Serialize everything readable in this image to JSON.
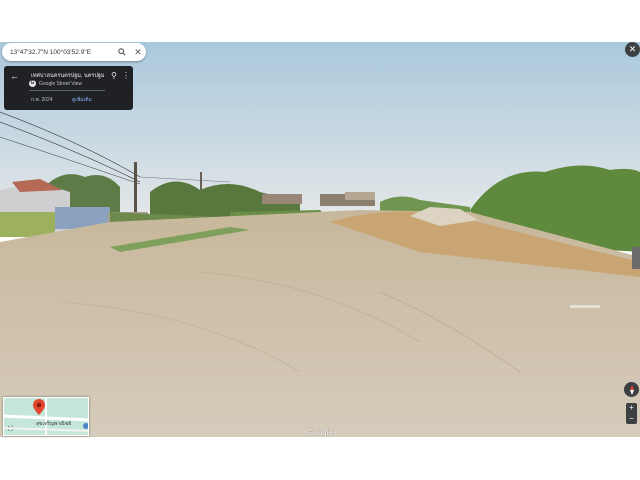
{
  "search": {
    "coordinates": "13°47'32.7\"N 100°03'52.9\"E"
  },
  "info_card": {
    "place": "เทศบาลนครนครปฐม, นครปฐม",
    "source": "Google Street View",
    "date": "ก.พ. 2024",
    "see_more": "ดูเพิ่มเติม"
  },
  "minimap": {
    "road_label": "สุขเจริญพาณิชย์"
  },
  "controls": {
    "zoom_in": "+",
    "zoom_out": "−",
    "close": "✕"
  },
  "footer": {
    "logo": "Google"
  },
  "icons": [
    "search-icon",
    "close-icon",
    "back-arrow-icon",
    "pin-icon",
    "more-icon",
    "street-view-icon",
    "expand-icon",
    "compass-icon",
    "map-pin-icon"
  ]
}
